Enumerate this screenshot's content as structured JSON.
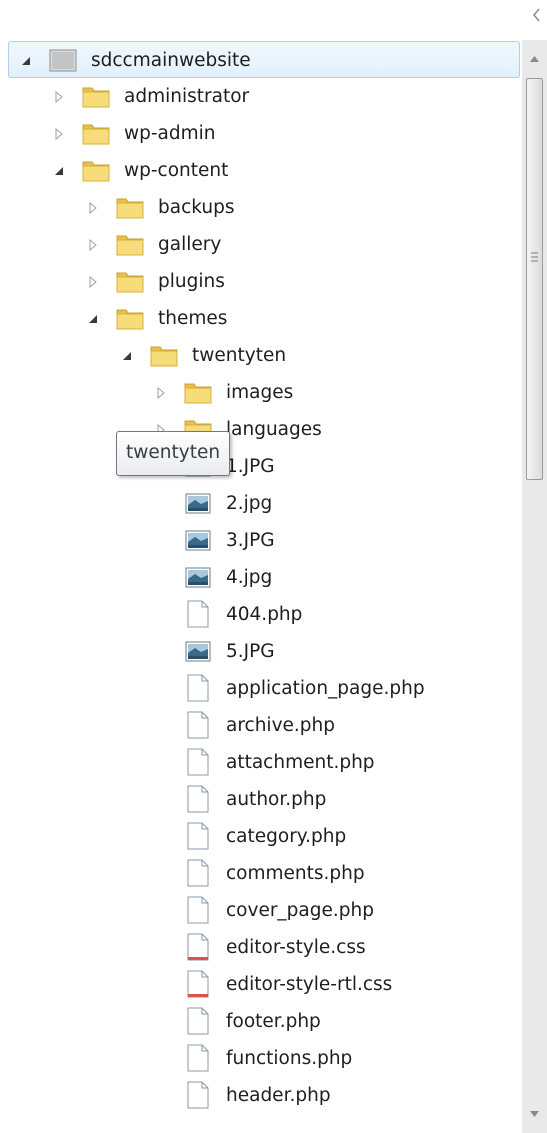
{
  "tree": {
    "items": [
      {
        "label": "sdccmainwebsite",
        "icon": "drive-icon",
        "expander": "expanded",
        "selected": true
      },
      {
        "label": "administrator",
        "icon": "folder-icon",
        "expander": "collapsed"
      },
      {
        "label": "wp-admin",
        "icon": "folder-icon",
        "expander": "collapsed"
      },
      {
        "label": "wp-content",
        "icon": "folder-icon",
        "expander": "expanded"
      },
      {
        "label": "backups",
        "icon": "folder-icon",
        "expander": "collapsed"
      },
      {
        "label": "gallery",
        "icon": "folder-icon",
        "expander": "collapsed"
      },
      {
        "label": "plugins",
        "icon": "folder-icon",
        "expander": "collapsed"
      },
      {
        "label": "themes",
        "icon": "folder-icon",
        "expander": "expanded"
      },
      {
        "label": "twentyten",
        "icon": "folder-icon",
        "expander": "expanded"
      },
      {
        "label": "images",
        "icon": "folder-icon",
        "expander": "collapsed"
      },
      {
        "label": "languages",
        "icon": "folder-icon",
        "expander": "collapsed"
      },
      {
        "label": "1.JPG",
        "icon": "image-file-icon"
      },
      {
        "label": "2.jpg",
        "icon": "image-file-icon"
      },
      {
        "label": "3.JPG",
        "icon": "image-file-icon"
      },
      {
        "label": "4.jpg",
        "icon": "image-file-icon"
      },
      {
        "label": "404.php",
        "icon": "document-icon"
      },
      {
        "label": "5.JPG",
        "icon": "image-file-icon"
      },
      {
        "label": "application_page.php",
        "icon": "document-icon"
      },
      {
        "label": "archive.php",
        "icon": "document-icon"
      },
      {
        "label": "attachment.php",
        "icon": "document-icon"
      },
      {
        "label": "author.php",
        "icon": "document-icon"
      },
      {
        "label": "category.php",
        "icon": "document-icon"
      },
      {
        "label": "comments.php",
        "icon": "document-icon"
      },
      {
        "label": "cover_page.php",
        "icon": "document-icon"
      },
      {
        "label": "editor-style.css",
        "icon": "css-file-icon"
      },
      {
        "label": "editor-style-rtl.css",
        "icon": "css-file-icon"
      },
      {
        "label": "footer.php",
        "icon": "document-icon"
      },
      {
        "label": "functions.php",
        "icon": "document-icon"
      },
      {
        "label": "header.php",
        "icon": "document-icon"
      }
    ]
  },
  "tooltip": {
    "text": "twentyten"
  },
  "colors": {
    "selection_border": "#a9d0f2",
    "folder": "#f2d46a",
    "css_accent": "#d9534f"
  }
}
